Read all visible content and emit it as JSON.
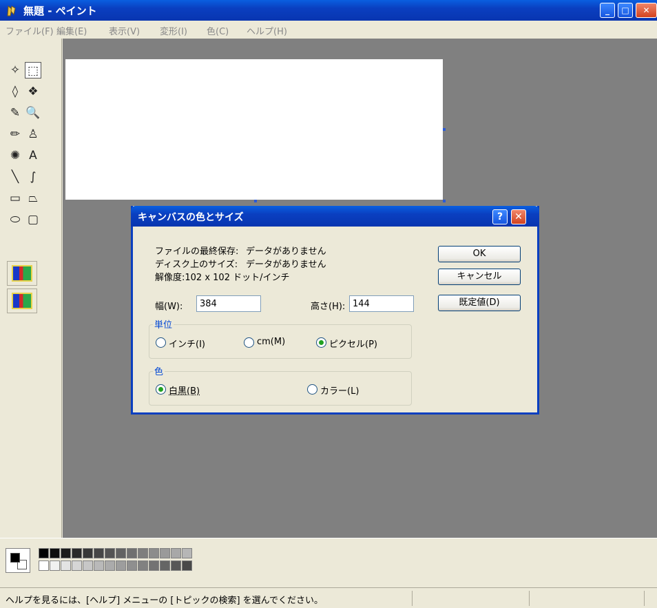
{
  "window": {
    "title": "無題 - ペイント",
    "app_icon": "paint-bucket-icon",
    "minimize": "_",
    "maximize": "□",
    "close": "✕"
  },
  "menu": [
    "ファイル(F)",
    "編集(E)",
    "表示(V)",
    "変形(I)",
    "色(C)",
    "ヘルプ(H)"
  ],
  "toolbox": {
    "tools": [
      {
        "name": "free-select-icon",
        "glyph": "✧"
      },
      {
        "name": "rect-select-icon",
        "glyph": "⬚"
      },
      {
        "name": "eraser-icon",
        "glyph": "◊"
      },
      {
        "name": "fill-bucket-icon",
        "glyph": "❖"
      },
      {
        "name": "color-picker-icon",
        "glyph": "✎"
      },
      {
        "name": "magnifier-icon",
        "glyph": "🔍"
      },
      {
        "name": "pencil-icon",
        "glyph": "✏"
      },
      {
        "name": "brush-icon",
        "glyph": "♙"
      },
      {
        "name": "airbrush-icon",
        "glyph": "✺"
      },
      {
        "name": "text-icon",
        "glyph": "A"
      },
      {
        "name": "line-icon",
        "glyph": "╲"
      },
      {
        "name": "curve-icon",
        "glyph": "∫"
      },
      {
        "name": "rectangle-icon",
        "glyph": "▭"
      },
      {
        "name": "polygon-icon",
        "glyph": "⏢"
      },
      {
        "name": "ellipse-icon",
        "glyph": "⬭"
      },
      {
        "name": "rounded-rect-icon",
        "glyph": "▢"
      }
    ],
    "selected_tool": "rect-select-icon"
  },
  "status_bar": {
    "text": "ヘルプを見るには、[ヘルプ] メニューの [トピックの検索] を選んでください。"
  },
  "dialog": {
    "title": "キャンバスの色とサイズ",
    "help_glyph": "?",
    "close_glyph": "✕",
    "info": [
      {
        "label": "ファイルの最終保存:",
        "value": "データがありません"
      },
      {
        "label": "ディスク上のサイズ:",
        "value": "データがありません"
      }
    ],
    "resolution": "解像度:102 x 102 ドット/インチ",
    "width_label": "幅(W):",
    "width_value": "384",
    "height_label": "高さ(H):",
    "height_value": "144",
    "units": {
      "title": "単位",
      "options": [
        "インチ(I)",
        "cm(M)",
        "ピクセル(P)"
      ],
      "selected": "ピクセル(P)"
    },
    "color": {
      "title": "色",
      "options": [
        "白黒(B)",
        "カラー(L)"
      ],
      "selected": "白黒(B)"
    },
    "buttons": {
      "ok": "OK",
      "cancel": "キャンセル",
      "default": "既定値(D)"
    }
  }
}
